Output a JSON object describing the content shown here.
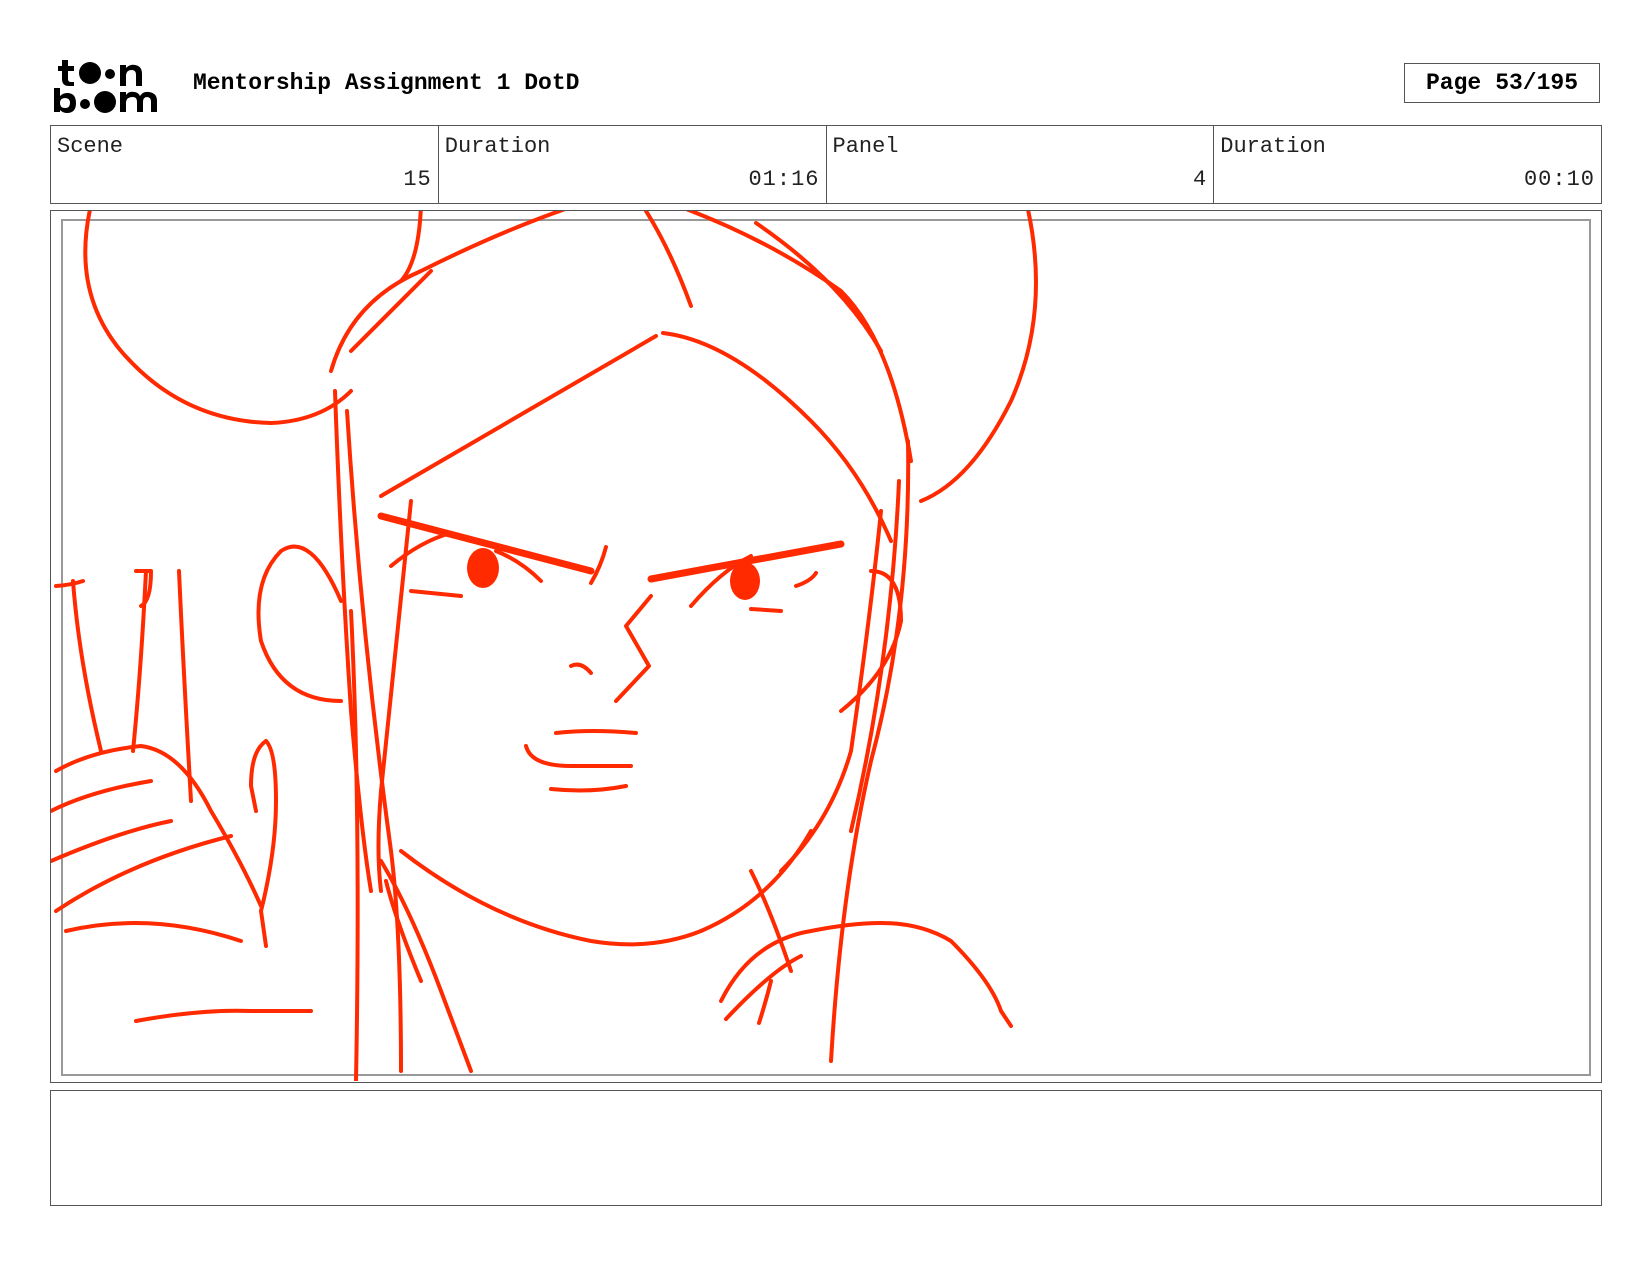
{
  "header": {
    "logo_text": "toon boom",
    "title": "Mentorship Assignment 1 DotD",
    "page_label": "Page",
    "page_value": "53/195"
  },
  "info": [
    {
      "label": "Scene",
      "value": "15"
    },
    {
      "label": "Duration",
      "value": "01:16"
    },
    {
      "label": "Panel",
      "value": "4"
    },
    {
      "label": "Duration",
      "value": "00:10"
    }
  ],
  "panel": {
    "sketch_subject": "character-portrait-sketch",
    "line_color": "#ff2a00"
  },
  "notes": {
    "text": ""
  }
}
